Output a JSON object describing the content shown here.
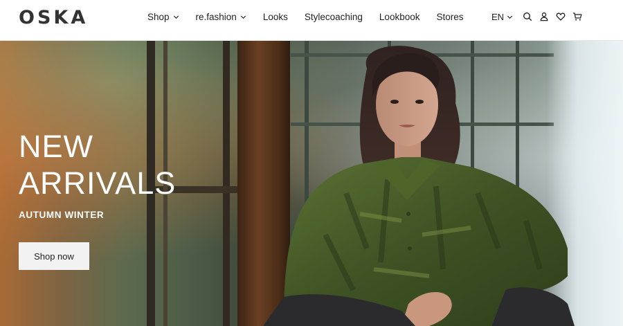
{
  "header": {
    "logo_text": "OSKA",
    "nav": [
      {
        "label": "Shop",
        "has_dropdown": true
      },
      {
        "label": "re.fashion",
        "has_dropdown": true
      },
      {
        "label": "Looks",
        "has_dropdown": false
      },
      {
        "label": "Stylecoaching",
        "has_dropdown": false
      },
      {
        "label": "Lookbook",
        "has_dropdown": false
      },
      {
        "label": "Stores",
        "has_dropdown": false
      }
    ],
    "language": "EN",
    "icons": [
      "search-icon",
      "account-icon",
      "wishlist-heart-icon",
      "cart-icon"
    ]
  },
  "hero": {
    "title_line1": "NEW",
    "title_line2": "ARRIVALS",
    "subtitle": "AUTUMN WINTER",
    "cta_label": "Shop now"
  },
  "colors": {
    "header_bg": "#ffffff",
    "hero_text": "#ffffff",
    "button_bg": "#f2f2f2",
    "shirt_green": "#4a5e2a"
  }
}
